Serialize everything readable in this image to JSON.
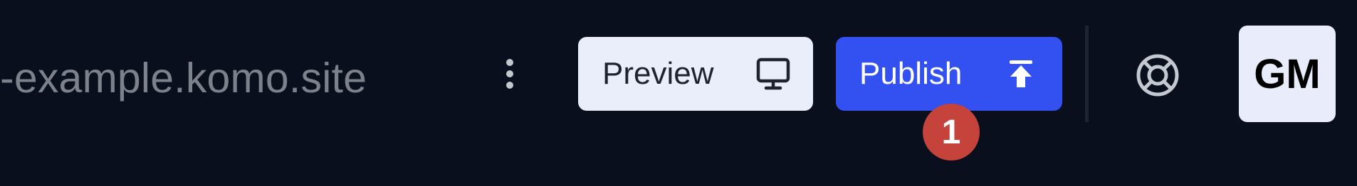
{
  "header": {
    "site_url": "-example.komo.site"
  },
  "menu": {
    "more_icon": "more-vertical-icon"
  },
  "preview": {
    "label": "Preview",
    "icon": "monitor-icon"
  },
  "publish": {
    "label": "Publish",
    "icon": "upload-icon",
    "accent": "#3350f0"
  },
  "annotation": {
    "badge_number": "1",
    "color": "#c5433b"
  },
  "help": {
    "icon": "lifebuoy-icon"
  },
  "user": {
    "initials": "GM"
  }
}
